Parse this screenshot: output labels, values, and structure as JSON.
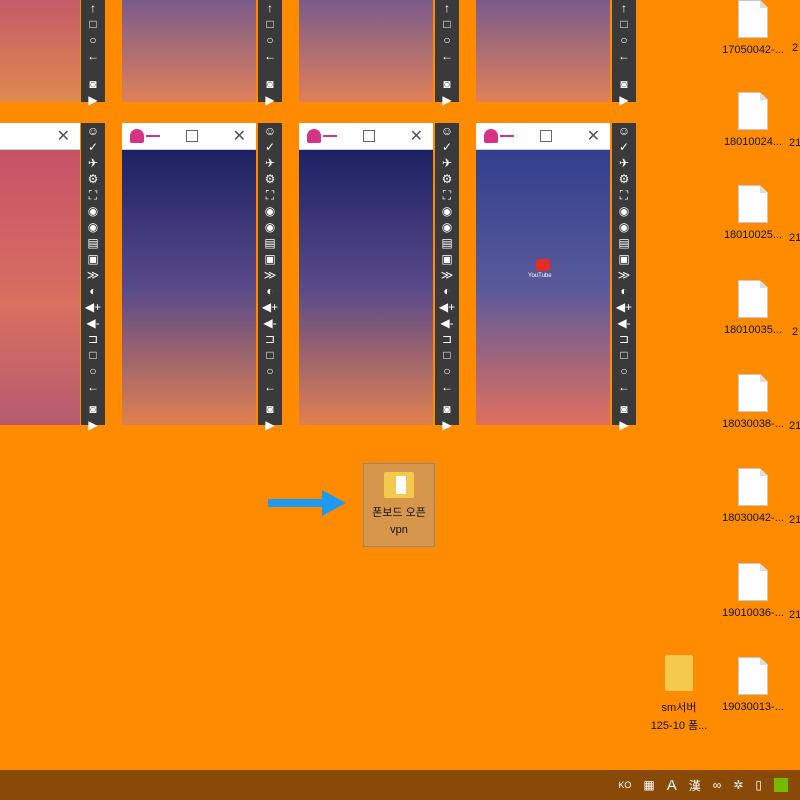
{
  "desktop": {
    "folder_selected": {
      "line1": "폰보드 오픈",
      "line2": "vpn"
    },
    "folder_sm": {
      "line1": "sm서버",
      "line2": "125-10 폼..."
    },
    "files": [
      {
        "label": "17050042-...",
        "suffix": "2"
      },
      {
        "label": "18010024...",
        "suffix": "21"
      },
      {
        "label": "18010025...",
        "suffix": "21"
      },
      {
        "label": "18010035...",
        "suffix": "2"
      },
      {
        "label": "18030038-...",
        "suffix": "21"
      },
      {
        "label": "18030042-...",
        "suffix": "21"
      },
      {
        "label": "19010036-...",
        "suffix": "21"
      },
      {
        "label": "19030013-...",
        "suffix": ""
      }
    ]
  },
  "emulator": {
    "app_label": "YouTube"
  },
  "taskbar": {
    "ime": "KO",
    "a": "A",
    "han": "漢"
  }
}
